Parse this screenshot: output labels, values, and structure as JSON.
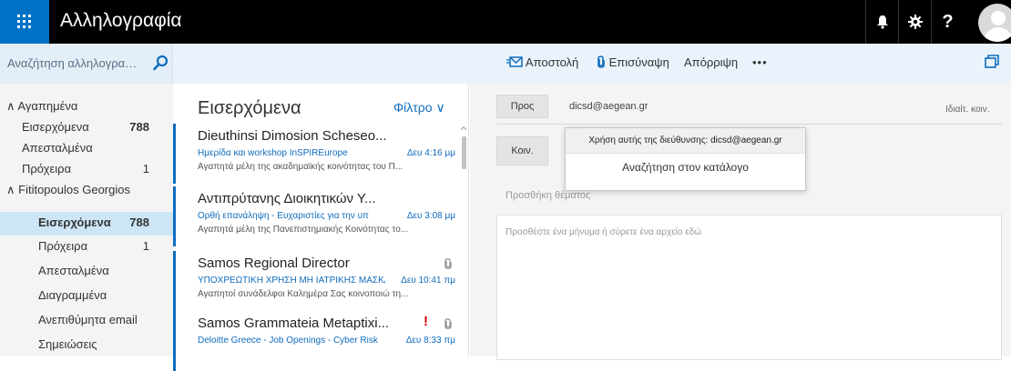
{
  "app": {
    "title": "Αλληλογραφία"
  },
  "topbar": {
    "icons": [
      "app-launcher-icon",
      "bell-icon",
      "gear-icon",
      "help-icon",
      "avatar"
    ],
    "help_label": "?",
    "brand_color": "#0072c6"
  },
  "search": {
    "placeholder": "Αναζήτηση αλληλογραφί..."
  },
  "toolbar": {
    "send_label": "Αποστολή",
    "attach_label": "Επισύναψη",
    "discard_label": "Απόρριψη",
    "more_label": "•••"
  },
  "folders": [
    {
      "label": "Αγαπημένα",
      "type": "group",
      "count": ""
    },
    {
      "label": "Εισερχόμενα",
      "count": "788",
      "unread": true
    },
    {
      "label": "Απεσταλμένα",
      "count": ""
    },
    {
      "label": "Πρόχειρα",
      "count": "1"
    },
    {
      "label": "Fititopoulos Georgios",
      "type": "group",
      "count": ""
    },
    {
      "label": "Εισερχόμενα",
      "count": "788",
      "selected": true
    },
    {
      "label": "Πρόχειρα",
      "count": "1"
    },
    {
      "label": "Απεσταλμένα",
      "count": ""
    },
    {
      "label": "Διαγραμμένα",
      "count": ""
    },
    {
      "label": "Ανεπιθύμητα email",
      "count": ""
    },
    {
      "label": "Σημειώσεις",
      "count": ""
    }
  ],
  "list": {
    "title": "Εισερχόμενα",
    "filter_label": "Φίλτρο ∨",
    "messages": [
      {
        "from": "Dieuthinsi Dimosion Scheseo...",
        "subject": "Ημερίδα και workshop InSPIREurope",
        "time": "Δευ 4:16 μμ",
        "preview": "Αγαπητά μέλη της ακαδημαϊκής κοινότητας του Π..."
      },
      {
        "from": "Αντιπρύτανης Διοικητικών Υ...",
        "subject": "Ορθή επανάληψη - Ευχαριστίες για την υπ",
        "time": "Δευ 3:08 μμ",
        "preview": "Αγαπητά μέλη της Πανεπιστημιακής Κοινότητας το..."
      },
      {
        "from": "Samos Regional Director",
        "subject": "ΥΠΟΧΡΕΩΤΙΚΗ ΧΡΗΣΗ ΜΗ ΙΑΤΡΙΚΗΣ ΜΑΣΚΑ",
        "time": "Δευ 10:41 πμ",
        "preview": "Αγαπητοί συνάδελφοι Καλημέρα Σας κοινοποιώ τη...",
        "attachment": true
      },
      {
        "from": "Samos Grammateia Metaptixi...",
        "subject": "Deloitte Greece - Job Openings - Cyber Risk",
        "time": "Δευ 8:33 πμ",
        "preview": "",
        "attachment": true,
        "important": true,
        "important_mark": "!"
      }
    ]
  },
  "compose": {
    "to_label": "Προς",
    "to_value": "dicsd@aegean.gr",
    "bcc_label": "Ιδιαίτ. κοιν.",
    "cc_label": "Κοιν.",
    "subject_placeholder": "Προσθήκη θέματος",
    "body_placeholder": "Προσθέστε ένα μήνυμα ή σύρετε ένα αρχείο εδώ"
  },
  "suggestions": {
    "use_address": "Χρήση αυτής της διεύθυνσης: dicsd@aegean.gr",
    "search_directory": "Αναζήτηση στον κατάλογο"
  }
}
